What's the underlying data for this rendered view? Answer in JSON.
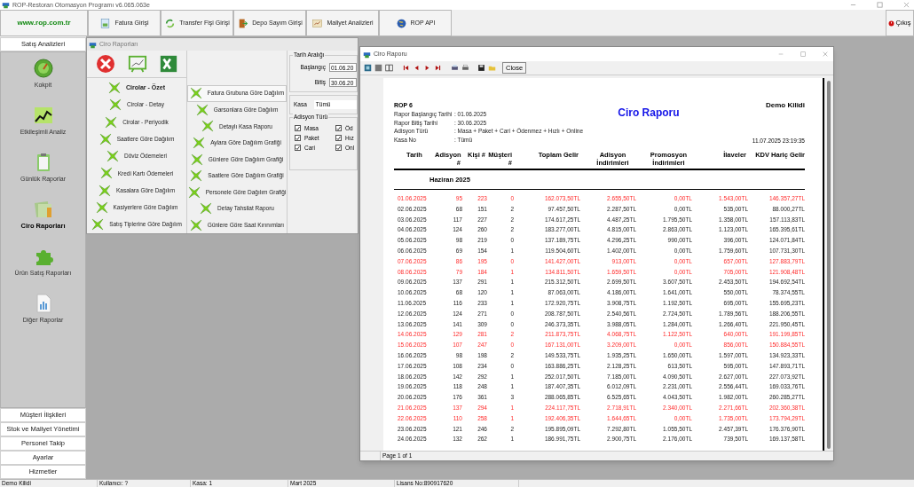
{
  "app_title": "ROP-Restoran Otomasyon Programı v6.065.063e",
  "website": "www.rop.com.tr",
  "toolbar": [
    {
      "label": "Fatura Girişi",
      "kind": "invoice"
    },
    {
      "label": "Transfer Fişi Girişi",
      "kind": "transfer"
    },
    {
      "label": "Depo Sayım Girişi",
      "kind": "door"
    },
    {
      "label": "Maliyet Analizleri",
      "kind": "analysis"
    },
    {
      "label": "ROP API",
      "kind": "globe"
    }
  ],
  "exit_button": "Çıkış",
  "sidebar": {
    "header": "Satış Analizleri",
    "items": [
      {
        "label": "Kokpit",
        "kind": "gauge",
        "selected": false
      },
      {
        "label": "Etkileşimli Analiz",
        "kind": "chart",
        "selected": false
      },
      {
        "label": "Günlük Raporlar",
        "kind": "clipboard",
        "selected": false
      },
      {
        "label": "Ciro Raporları",
        "kind": "money",
        "selected": true
      },
      {
        "label": "Ürün Satış Raporları",
        "kind": "puzzle",
        "selected": false
      },
      {
        "label": "Diğer Raporlar",
        "kind": "document",
        "selected": false
      }
    ],
    "sections": [
      "Müşteri İlişkileri",
      "Stok ve Maliyet Yönetimi",
      "Personel Takip",
      "Ayarlar",
      "Hizmetler"
    ]
  },
  "reports_window": {
    "title": "Ciro Raporları",
    "left_list": [
      {
        "label": "Cirolar - Özet",
        "selected": true
      },
      {
        "label": "Cirolar - Detay",
        "selected": false
      },
      {
        "label": "Cirolar - Periyodik",
        "selected": false
      },
      {
        "label": "Saatlere Göre Dağılım",
        "selected": false
      },
      {
        "label": "Döviz Ödemeleri",
        "selected": false
      },
      {
        "label": "Kredi Kartı Ödemeleri",
        "selected": false
      },
      {
        "label": "Kasalara Göre Dağılım",
        "selected": false
      },
      {
        "label": "Kasiyerlere Göre Dağılım",
        "selected": false
      },
      {
        "label": "Satış Tiplerine Göre Dağılım",
        "selected": false
      }
    ],
    "right_list": [
      {
        "label": "Fatura Grubuna Göre Dağılım",
        "selected": true
      },
      {
        "label": "Garsonlara Göre Dağılım",
        "selected": false
      },
      {
        "label": "Detaylı Kasa Raporu",
        "selected": false
      },
      {
        "label": "Aylara Göre Dağılım Grafiği",
        "selected": false
      },
      {
        "label": "Günlere Göre Dağılım Grafiği",
        "selected": false
      },
      {
        "label": "Saatlere Göre Dağılım Grafiği",
        "selected": false
      },
      {
        "label": "Personele Göre Dağılım Grafiği",
        "selected": false
      },
      {
        "label": "Detay Tahsilat Raporu",
        "selected": false
      },
      {
        "label": "Günlere Göre Saat Kırınımları",
        "selected": false
      }
    ],
    "date_range": {
      "title": "Tarih Aralığı",
      "start_label": "Başlangıç",
      "start": "01.06.20",
      "end_label": "Bitiş",
      "end": "30.06.20"
    },
    "kasa": {
      "label": "Kasa",
      "value": "Tümü"
    },
    "order_types": {
      "title": "Adisyon Türü",
      "items": [
        {
          "label": "Masa",
          "checked": true
        },
        {
          "label": "Öd",
          "checked": true
        },
        {
          "label": "Paket",
          "checked": true
        },
        {
          "label": "Hız",
          "checked": true
        },
        {
          "label": "Cari",
          "checked": true
        },
        {
          "label": "Onl",
          "checked": true
        }
      ]
    }
  },
  "report": {
    "title": "Ciro Raporu",
    "close_button": "Close",
    "code": "ROP 6",
    "heading": "Ciro Raporu",
    "lock": "Demo Kilidi",
    "meta": [
      {
        "label": "Rapor Başlangıç Tarihi",
        "value": ": 01.06.2025"
      },
      {
        "label": "Rapor Bitiş Tarihi",
        "value": ": 30.06.2025"
      },
      {
        "label": "Adisyon Türü",
        "value": ": Masa + Paket + Cari + Ödenmez + Hızlı + Online"
      },
      {
        "label": "Kasa No",
        "value": ": Tümü"
      }
    ],
    "printed_at": "11.07.2025 23:19:35",
    "columns": [
      "Tarih",
      "Adisyon #",
      "Kişi #",
      "Müşteri #",
      "Toplam Gelir",
      "Adisyon İndirimleri",
      "Promosyon İndirimleri",
      "İlaveler",
      "KDV Hariç Gelir"
    ],
    "group": "Haziran 2025",
    "rows": [
      {
        "highlighted": true,
        "cells": [
          "01.06.2025",
          "95",
          "223",
          "0",
          "162.073,50TL",
          "2.655,50TL",
          "0,00TL",
          "1.543,00TL",
          "146.357,27TL"
        ]
      },
      {
        "highlighted": false,
        "cells": [
          "02.06.2025",
          "68",
          "151",
          "2",
          "97.457,50TL",
          "2.287,50TL",
          "0,00TL",
          "535,00TL",
          "88.000,27TL"
        ]
      },
      {
        "highlighted": false,
        "cells": [
          "03.06.2025",
          "117",
          "227",
          "2",
          "174.617,25TL",
          "4.487,25TL",
          "1.795,50TL",
          "1.358,00TL",
          "157.113,83TL"
        ]
      },
      {
        "highlighted": false,
        "cells": [
          "04.06.2025",
          "124",
          "260",
          "2",
          "183.277,00TL",
          "4.815,00TL",
          "2.863,00TL",
          "1.123,00TL",
          "165.395,61TL"
        ]
      },
      {
        "highlighted": false,
        "cells": [
          "05.06.2025",
          "98",
          "219",
          "0",
          "137.189,75TL",
          "4.296,25TL",
          "990,00TL",
          "396,00TL",
          "124.071,84TL"
        ]
      },
      {
        "highlighted": false,
        "cells": [
          "06.06.2025",
          "69",
          "154",
          "1",
          "119.504,60TL",
          "1.402,00TL",
          "0,00TL",
          "1.759,60TL",
          "107.731,30TL"
        ]
      },
      {
        "highlighted": true,
        "cells": [
          "07.06.2025",
          "86",
          "195",
          "0",
          "141.427,00TL",
          "913,00TL",
          "0,00TL",
          "657,00TL",
          "127.883,79TL"
        ]
      },
      {
        "highlighted": true,
        "cells": [
          "08.06.2025",
          "79",
          "184",
          "1",
          "134.811,50TL",
          "1.659,50TL",
          "0,00TL",
          "705,00TL",
          "121.908,48TL"
        ]
      },
      {
        "highlighted": false,
        "cells": [
          "09.06.2025",
          "137",
          "291",
          "1",
          "215.312,50TL",
          "2.699,50TL",
          "3.607,50TL",
          "2.453,50TL",
          "194.692,54TL"
        ]
      },
      {
        "highlighted": false,
        "cells": [
          "10.06.2025",
          "68",
          "120",
          "1",
          "87.063,00TL",
          "4.186,00TL",
          "1.641,00TL",
          "550,00TL",
          "78.374,55TL"
        ]
      },
      {
        "highlighted": false,
        "cells": [
          "11.06.2025",
          "116",
          "233",
          "1",
          "172.920,75TL",
          "3.908,75TL",
          "1.192,50TL",
          "695,00TL",
          "155.695,23TL"
        ]
      },
      {
        "highlighted": false,
        "cells": [
          "12.06.2025",
          "124",
          "271",
          "0",
          "208.787,50TL",
          "2.540,56TL",
          "2.724,50TL",
          "1.789,56TL",
          "188.206,55TL"
        ]
      },
      {
        "highlighted": false,
        "cells": [
          "13.06.2025",
          "141",
          "309",
          "0",
          "246.373,35TL",
          "3.988,05TL",
          "1.284,00TL",
          "1.266,40TL",
          "221.950,45TL"
        ]
      },
      {
        "highlighted": true,
        "cells": [
          "14.06.2025",
          "129",
          "281",
          "2",
          "211.873,75TL",
          "4.068,75TL",
          "1.122,50TL",
          "640,00TL",
          "191.199,85TL"
        ]
      },
      {
        "highlighted": true,
        "cells": [
          "15.06.2025",
          "107",
          "247",
          "0",
          "167.131,00TL",
          "3.209,00TL",
          "0,00TL",
          "856,00TL",
          "150.884,55TL"
        ]
      },
      {
        "highlighted": false,
        "cells": [
          "16.06.2025",
          "98",
          "198",
          "2",
          "149.533,75TL",
          "1.935,25TL",
          "1.650,00TL",
          "1.597,00TL",
          "134.923,33TL"
        ]
      },
      {
        "highlighted": false,
        "cells": [
          "17.06.2025",
          "108",
          "234",
          "0",
          "163.886,25TL",
          "2.128,25TL",
          "613,50TL",
          "595,00TL",
          "147.893,71TL"
        ]
      },
      {
        "highlighted": false,
        "cells": [
          "18.06.2025",
          "142",
          "292",
          "1",
          "252.017,50TL",
          "7.185,00TL",
          "4.090,50TL",
          "2.627,00TL",
          "227.073,92TL"
        ]
      },
      {
        "highlighted": false,
        "cells": [
          "19.06.2025",
          "118",
          "248",
          "1",
          "187.407,35TL",
          "6.012,09TL",
          "2.231,00TL",
          "2.556,44TL",
          "169.033,76TL"
        ]
      },
      {
        "highlighted": false,
        "cells": [
          "20.06.2025",
          "176",
          "361",
          "3",
          "288.065,85TL",
          "6.525,65TL",
          "4.043,50TL",
          "1.982,00TL",
          "260.285,27TL"
        ]
      },
      {
        "highlighted": true,
        "cells": [
          "21.06.2025",
          "137",
          "294",
          "1",
          "224.117,75TL",
          "2.718,91TL",
          "2.340,00TL",
          "2.271,66TL",
          "202.360,38TL"
        ]
      },
      {
        "highlighted": true,
        "cells": [
          "22.06.2025",
          "110",
          "258",
          "1",
          "192.406,35TL",
          "1.644,65TL",
          "0,00TL",
          "1.735,00TL",
          "173.794,29TL"
        ]
      },
      {
        "highlighted": false,
        "cells": [
          "23.06.2025",
          "121",
          "246",
          "2",
          "195.895,09TL",
          "7.292,80TL",
          "1.055,50TL",
          "2.457,39TL",
          "176.376,90TL"
        ]
      },
      {
        "highlighted": false,
        "cells": [
          "24.06.2025",
          "132",
          "262",
          "1",
          "186.991,75TL",
          "2.900,75TL",
          "2.176,00TL",
          "739,50TL",
          "169.137,58TL"
        ]
      }
    ],
    "footer": "Page 1 of 1"
  },
  "status_bar": [
    "Demo Kilidi",
    "Kullanıcı: ?",
    "Kasa: 1",
    "Mart 2025",
    "Lisans No:890917620"
  ]
}
